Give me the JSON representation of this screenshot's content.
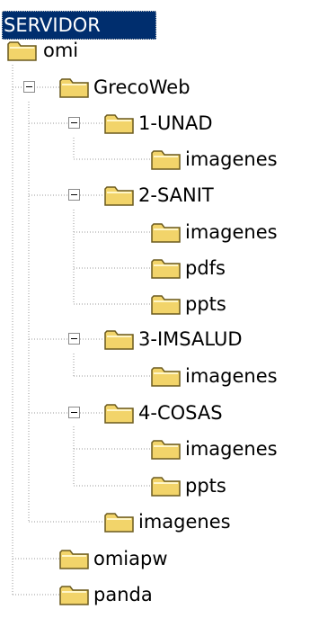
{
  "root_label": "SERVIDOR",
  "nodes": [
    {
      "name": "omi",
      "depth": 0,
      "expanded": false
    },
    {
      "name": "GrecoWeb",
      "depth": 1,
      "expanded": true
    },
    {
      "name": "1-UNAD",
      "depth": 2,
      "expanded": true
    },
    {
      "name": "imagenes",
      "depth": 3,
      "expanded": false
    },
    {
      "name": "2-SANIT",
      "depth": 2,
      "expanded": true
    },
    {
      "name": "imagenes",
      "depth": 3,
      "expanded": false
    },
    {
      "name": "pdfs",
      "depth": 3,
      "expanded": false
    },
    {
      "name": "ppts",
      "depth": 3,
      "expanded": false
    },
    {
      "name": "3-IMSALUD",
      "depth": 2,
      "expanded": true
    },
    {
      "name": "imagenes",
      "depth": 3,
      "expanded": false
    },
    {
      "name": "4-COSAS",
      "depth": 2,
      "expanded": true
    },
    {
      "name": "imagenes",
      "depth": 3,
      "expanded": false
    },
    {
      "name": "ppts",
      "depth": 3,
      "expanded": false
    },
    {
      "name": "imagenes",
      "depth": 2,
      "expanded": false
    },
    {
      "name": "omiapw",
      "depth": 1,
      "expanded": false
    },
    {
      "name": "panda",
      "depth": 1,
      "expanded": false
    }
  ],
  "colors": {
    "selection": "#002e6e",
    "folder_fill": "#f2d46a",
    "folder_outline": "#6b5a1e",
    "guide": "#9a9a9a"
  }
}
